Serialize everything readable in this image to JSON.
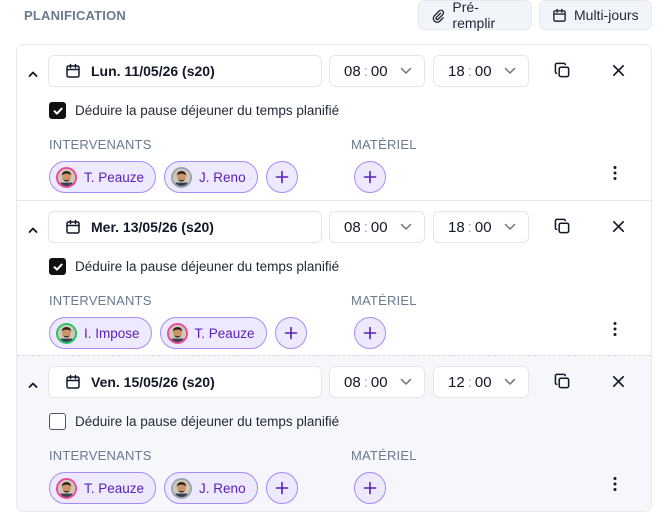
{
  "header": {
    "title": "PLANIFICATION",
    "prefill_label": "Pré-remplir",
    "multi_label": "Multi-jours"
  },
  "labels": {
    "lunch": "Déduire la pause déjeuner du temps planifié",
    "intervenants": "INTERVENANTS",
    "materiel": "MATÉRIEL"
  },
  "days": [
    {
      "date": "Lun. 11/05/26 (s20)",
      "start_h": "08",
      "start_m": "00",
      "end_h": "18",
      "end_m": "00",
      "lunch_checked": true,
      "people": [
        {
          "name": "T. Peauze",
          "ring": "pink"
        },
        {
          "name": "J. Reno",
          "ring": "gray"
        }
      ]
    },
    {
      "date": "Mer. 13/05/26 (s20)",
      "start_h": "08",
      "start_m": "00",
      "end_h": "18",
      "end_m": "00",
      "lunch_checked": true,
      "people": [
        {
          "name": "I. Impose",
          "ring": "green"
        },
        {
          "name": "T. Peauze",
          "ring": "pink"
        }
      ]
    },
    {
      "date": "Ven. 15/05/26 (s20)",
      "start_h": "08",
      "start_m": "00",
      "end_h": "12",
      "end_m": "00",
      "lunch_checked": false,
      "people": [
        {
          "name": "T. Peauze",
          "ring": "pink"
        },
        {
          "name": "J. Reno",
          "ring": "gray"
        }
      ]
    }
  ],
  "colors": {
    "accent": "#7c3aed",
    "chip_bg": "#ede9fe",
    "chip_border": "#a78bfa",
    "label_gray": "#6b7a90"
  },
  "icons": {
    "prefill": "paperclip-icon",
    "multi": "calendar-icon",
    "collapse": "chevron-up-icon",
    "date": "calendar-icon",
    "dropdown": "chevron-down-icon",
    "duplicate": "copy-icon",
    "remove": "close-icon",
    "add": "plus-icon",
    "more": "kebab-icon"
  }
}
